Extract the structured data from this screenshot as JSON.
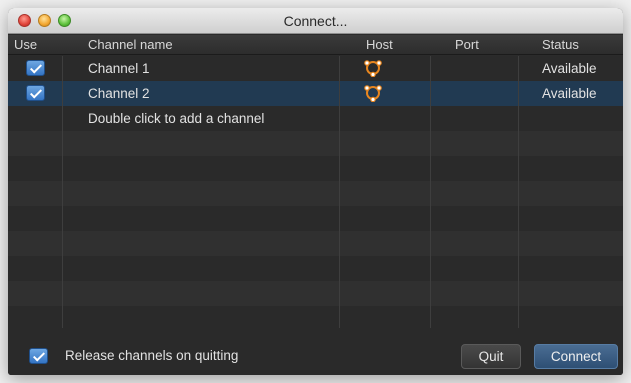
{
  "window": {
    "title": "Connect..."
  },
  "columns": {
    "use": "Use",
    "channel_name": "Channel name",
    "host": "Host",
    "port": "Port",
    "status": "Status"
  },
  "rows": [
    {
      "use": true,
      "channel_name": "Channel 1",
      "host_icon": "network-node-icon",
      "port": "",
      "status": "Available",
      "selected": false
    },
    {
      "use": true,
      "channel_name": "Channel 2",
      "host_icon": "network-node-icon",
      "port": "",
      "status": "Available",
      "selected": true
    }
  ],
  "add_row_hint": "Double click to add a channel",
  "footer": {
    "release_checkbox_checked": true,
    "release_label": "Release channels on quitting",
    "quit_label": "Quit",
    "connect_label": "Connect"
  },
  "colors": {
    "selection": "#213a52",
    "accent": "#3474c4",
    "host_icon_orange": "#e8861f"
  }
}
